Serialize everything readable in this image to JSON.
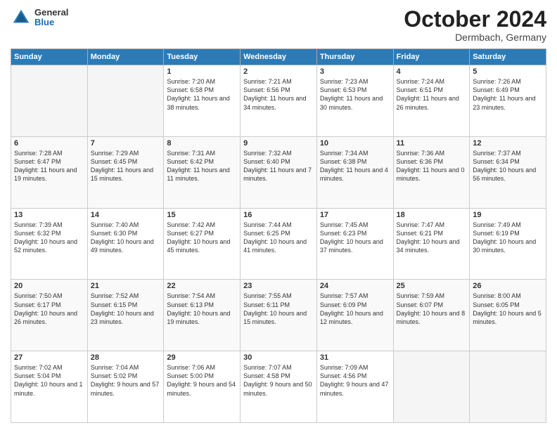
{
  "header": {
    "logo_general": "General",
    "logo_blue": "Blue",
    "month": "October 2024",
    "location": "Dermbach, Germany"
  },
  "weekdays": [
    "Sunday",
    "Monday",
    "Tuesday",
    "Wednesday",
    "Thursday",
    "Friday",
    "Saturday"
  ],
  "weeks": [
    [
      {
        "day": "",
        "empty": true
      },
      {
        "day": "",
        "empty": true
      },
      {
        "day": "1",
        "sunrise": "Sunrise: 7:20 AM",
        "sunset": "Sunset: 6:58 PM",
        "daylight": "Daylight: 11 hours and 38 minutes."
      },
      {
        "day": "2",
        "sunrise": "Sunrise: 7:21 AM",
        "sunset": "Sunset: 6:56 PM",
        "daylight": "Daylight: 11 hours and 34 minutes."
      },
      {
        "day": "3",
        "sunrise": "Sunrise: 7:23 AM",
        "sunset": "Sunset: 6:53 PM",
        "daylight": "Daylight: 11 hours and 30 minutes."
      },
      {
        "day": "4",
        "sunrise": "Sunrise: 7:24 AM",
        "sunset": "Sunset: 6:51 PM",
        "daylight": "Daylight: 11 hours and 26 minutes."
      },
      {
        "day": "5",
        "sunrise": "Sunrise: 7:26 AM",
        "sunset": "Sunset: 6:49 PM",
        "daylight": "Daylight: 11 hours and 23 minutes."
      }
    ],
    [
      {
        "day": "6",
        "sunrise": "Sunrise: 7:28 AM",
        "sunset": "Sunset: 6:47 PM",
        "daylight": "Daylight: 11 hours and 19 minutes."
      },
      {
        "day": "7",
        "sunrise": "Sunrise: 7:29 AM",
        "sunset": "Sunset: 6:45 PM",
        "daylight": "Daylight: 11 hours and 15 minutes."
      },
      {
        "day": "8",
        "sunrise": "Sunrise: 7:31 AM",
        "sunset": "Sunset: 6:42 PM",
        "daylight": "Daylight: 11 hours and 11 minutes."
      },
      {
        "day": "9",
        "sunrise": "Sunrise: 7:32 AM",
        "sunset": "Sunset: 6:40 PM",
        "daylight": "Daylight: 11 hours and 7 minutes."
      },
      {
        "day": "10",
        "sunrise": "Sunrise: 7:34 AM",
        "sunset": "Sunset: 6:38 PM",
        "daylight": "Daylight: 11 hours and 4 minutes."
      },
      {
        "day": "11",
        "sunrise": "Sunrise: 7:36 AM",
        "sunset": "Sunset: 6:36 PM",
        "daylight": "Daylight: 11 hours and 0 minutes."
      },
      {
        "day": "12",
        "sunrise": "Sunrise: 7:37 AM",
        "sunset": "Sunset: 6:34 PM",
        "daylight": "Daylight: 10 hours and 56 minutes."
      }
    ],
    [
      {
        "day": "13",
        "sunrise": "Sunrise: 7:39 AM",
        "sunset": "Sunset: 6:32 PM",
        "daylight": "Daylight: 10 hours and 52 minutes."
      },
      {
        "day": "14",
        "sunrise": "Sunrise: 7:40 AM",
        "sunset": "Sunset: 6:30 PM",
        "daylight": "Daylight: 10 hours and 49 minutes."
      },
      {
        "day": "15",
        "sunrise": "Sunrise: 7:42 AM",
        "sunset": "Sunset: 6:27 PM",
        "daylight": "Daylight: 10 hours and 45 minutes."
      },
      {
        "day": "16",
        "sunrise": "Sunrise: 7:44 AM",
        "sunset": "Sunset: 6:25 PM",
        "daylight": "Daylight: 10 hours and 41 minutes."
      },
      {
        "day": "17",
        "sunrise": "Sunrise: 7:45 AM",
        "sunset": "Sunset: 6:23 PM",
        "daylight": "Daylight: 10 hours and 37 minutes."
      },
      {
        "day": "18",
        "sunrise": "Sunrise: 7:47 AM",
        "sunset": "Sunset: 6:21 PM",
        "daylight": "Daylight: 10 hours and 34 minutes."
      },
      {
        "day": "19",
        "sunrise": "Sunrise: 7:49 AM",
        "sunset": "Sunset: 6:19 PM",
        "daylight": "Daylight: 10 hours and 30 minutes."
      }
    ],
    [
      {
        "day": "20",
        "sunrise": "Sunrise: 7:50 AM",
        "sunset": "Sunset: 6:17 PM",
        "daylight": "Daylight: 10 hours and 26 minutes."
      },
      {
        "day": "21",
        "sunrise": "Sunrise: 7:52 AM",
        "sunset": "Sunset: 6:15 PM",
        "daylight": "Daylight: 10 hours and 23 minutes."
      },
      {
        "day": "22",
        "sunrise": "Sunrise: 7:54 AM",
        "sunset": "Sunset: 6:13 PM",
        "daylight": "Daylight: 10 hours and 19 minutes."
      },
      {
        "day": "23",
        "sunrise": "Sunrise: 7:55 AM",
        "sunset": "Sunset: 6:11 PM",
        "daylight": "Daylight: 10 hours and 15 minutes."
      },
      {
        "day": "24",
        "sunrise": "Sunrise: 7:57 AM",
        "sunset": "Sunset: 6:09 PM",
        "daylight": "Daylight: 10 hours and 12 minutes."
      },
      {
        "day": "25",
        "sunrise": "Sunrise: 7:59 AM",
        "sunset": "Sunset: 6:07 PM",
        "daylight": "Daylight: 10 hours and 8 minutes."
      },
      {
        "day": "26",
        "sunrise": "Sunrise: 8:00 AM",
        "sunset": "Sunset: 6:05 PM",
        "daylight": "Daylight: 10 hours and 5 minutes."
      }
    ],
    [
      {
        "day": "27",
        "sunrise": "Sunrise: 7:02 AM",
        "sunset": "Sunset: 5:04 PM",
        "daylight": "Daylight: 10 hours and 1 minute."
      },
      {
        "day": "28",
        "sunrise": "Sunrise: 7:04 AM",
        "sunset": "Sunset: 5:02 PM",
        "daylight": "Daylight: 9 hours and 57 minutes."
      },
      {
        "day": "29",
        "sunrise": "Sunrise: 7:06 AM",
        "sunset": "Sunset: 5:00 PM",
        "daylight": "Daylight: 9 hours and 54 minutes."
      },
      {
        "day": "30",
        "sunrise": "Sunrise: 7:07 AM",
        "sunset": "Sunset: 4:58 PM",
        "daylight": "Daylight: 9 hours and 50 minutes."
      },
      {
        "day": "31",
        "sunrise": "Sunrise: 7:09 AM",
        "sunset": "Sunset: 4:56 PM",
        "daylight": "Daylight: 9 hours and 47 minutes."
      },
      {
        "day": "",
        "empty": true
      },
      {
        "day": "",
        "empty": true
      }
    ]
  ]
}
